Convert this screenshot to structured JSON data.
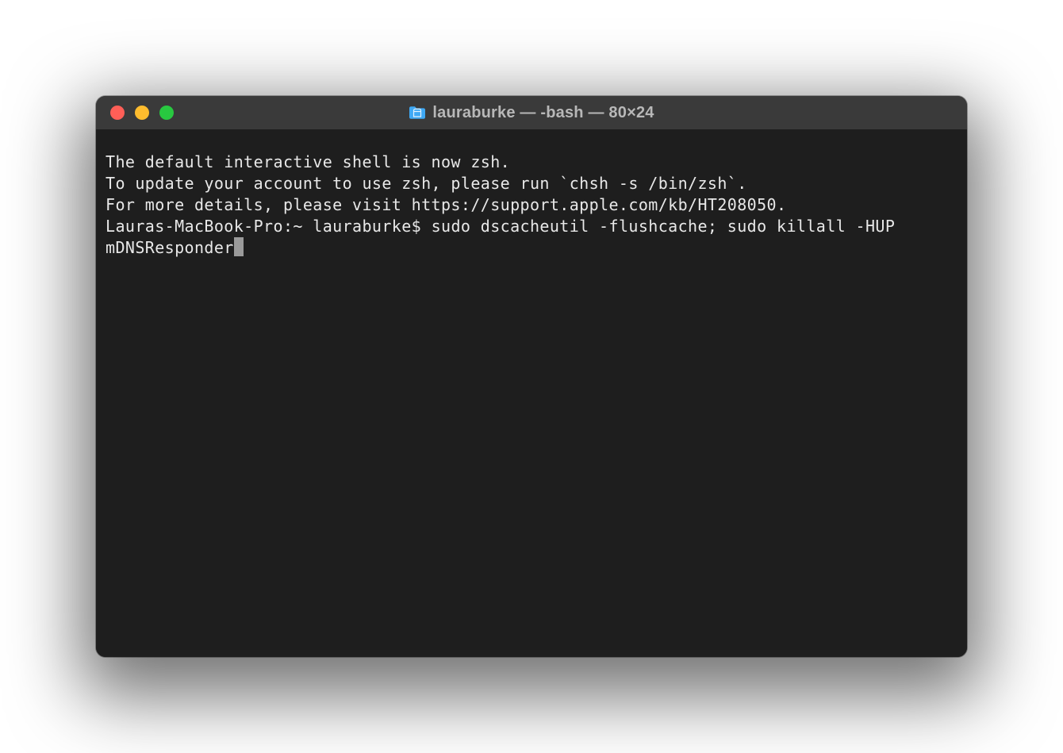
{
  "window": {
    "title": "lauraburke — -bash — 80×24"
  },
  "terminal": {
    "lines": [
      "The default interactive shell is now zsh.",
      "To update your account to use zsh, please run `chsh -s /bin/zsh`.",
      "For more details, please visit https://support.apple.com/kb/HT208050."
    ],
    "prompt": "Lauras-MacBook-Pro:~ lauraburke$ ",
    "command": "sudo dscacheutil -flushcache; sudo killall -HUP mDNSResponder"
  }
}
